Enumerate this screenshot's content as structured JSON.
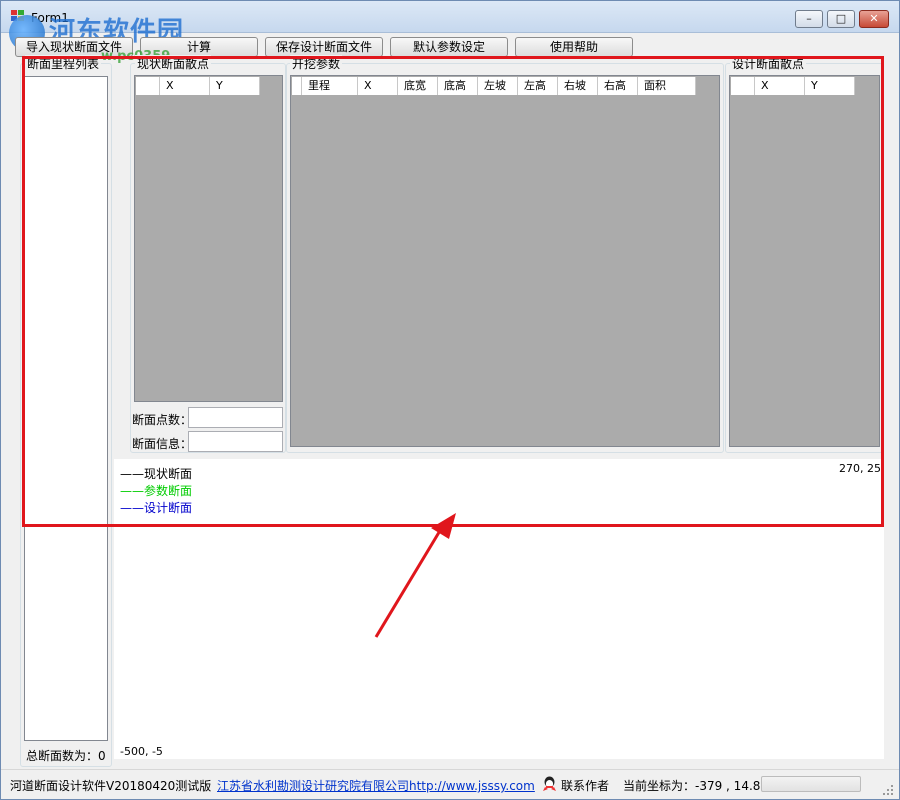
{
  "window": {
    "title": "Form1",
    "minimize_glyph": "–",
    "maximize_glyph": "□",
    "close_glyph": "✕"
  },
  "watermark": {
    "text": "河东软件园",
    "sub": "w.pc0359"
  },
  "toolbar": {
    "import": "导入现状断面文件",
    "calculate": "计算",
    "save": "保存设计断面文件",
    "defaults": "默认参数设定",
    "help": "使用帮助"
  },
  "panels": {
    "mileage_list": "断面里程列表",
    "current_points": "现状断面散点",
    "excavation_params": "开挖参数",
    "design_points": "设计断面散点"
  },
  "current_grid": {
    "columns": [
      "",
      "X",
      "Y"
    ]
  },
  "excavation_grid": {
    "columns": [
      "",
      "里程",
      "X",
      "底宽",
      "底高",
      "左坡",
      "左高",
      "右坡",
      "右高",
      "面积"
    ]
  },
  "design_grid": {
    "columns": [
      "",
      "X",
      "Y"
    ]
  },
  "fields": {
    "point_count": "断面点数：",
    "section_info": "断面信息："
  },
  "legend": {
    "current": "——现状断面",
    "param": "——参数断面",
    "design": "——设计断面"
  },
  "canvas": {
    "top_right_coord": "270, 25",
    "bottom_left_coord": "-500, -5"
  },
  "total_count": "总断面数为：0",
  "status": {
    "version": "河道断面设计软件V20180420测试版",
    "company_link": "江苏省水利勘测设计研究院有限公司http://www.jsssy.com",
    "contact": "联系作者",
    "coords": "当前坐标为：-379 , 14.8"
  },
  "colors": {
    "accent_red": "#e0161c",
    "legend_current": "#000000",
    "legend_param": "#00cc00",
    "legend_design": "#0000cc",
    "grid_bg": "#ababab"
  }
}
